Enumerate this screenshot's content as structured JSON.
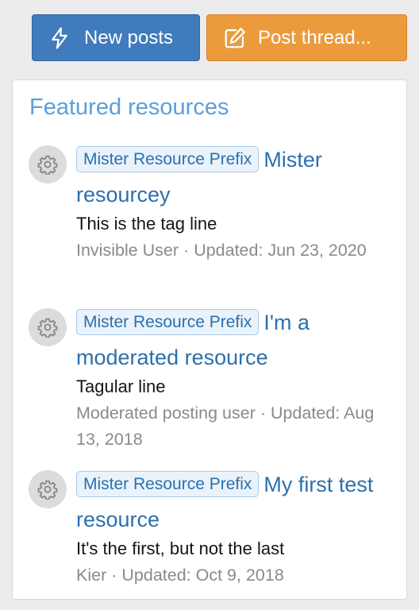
{
  "actions": {
    "new_posts_label": "New posts",
    "post_thread_label": "Post thread..."
  },
  "featured": {
    "title": "Featured resources",
    "items": [
      {
        "prefix": "Mister Resource Prefix",
        "title": "Mister resourcey",
        "tagline": "This is the tag line",
        "author": "Invisible User",
        "separator": "·",
        "updated_label": "Updated:",
        "updated_date": "Jun 23, 2020"
      },
      {
        "prefix": "Mister Resource Prefix",
        "title": "I'm a moderated resource",
        "tagline": "Tagular line",
        "author": "Moderated posting user",
        "separator": "·",
        "updated_label": "Updated:",
        "updated_date": "Aug 13, 2018"
      },
      {
        "prefix": "Mister Resource Prefix",
        "title": "My first test resource",
        "tagline": "It's the first, but not the last",
        "author": "Kier",
        "separator": "·",
        "updated_label": "Updated:",
        "updated_date": "Oct 9, 2018"
      }
    ]
  }
}
